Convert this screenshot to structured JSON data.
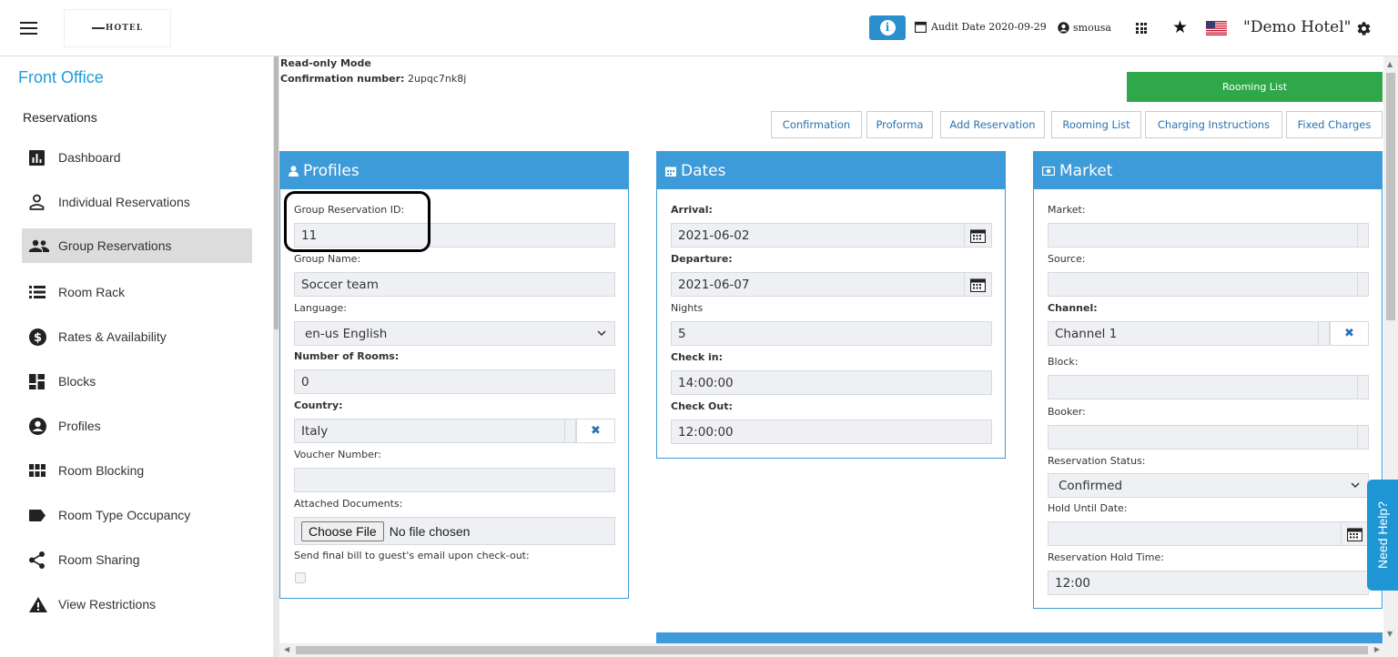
{
  "topbar": {
    "logo_text": "HOTEL",
    "audit_date": "Audit Date 2020-09-29",
    "username": "smousa",
    "hotel_name": "\"Demo Hotel\""
  },
  "sidebar": {
    "title": "Front Office",
    "section": "Reservations",
    "items": [
      {
        "label": "Dashboard",
        "icon": "bar-chart-icon"
      },
      {
        "label": "Individual Reservations",
        "icon": "person-icon"
      },
      {
        "label": "Group Reservations",
        "icon": "group-icon",
        "active": true
      },
      {
        "label": "Room Rack",
        "icon": "list-icon"
      },
      {
        "label": "Rates & Availability",
        "icon": "dollar-icon"
      },
      {
        "label": "Blocks",
        "icon": "dashboard-blocks-icon"
      },
      {
        "label": "Profiles",
        "icon": "account-circle-icon"
      },
      {
        "label": "Room Blocking",
        "icon": "grid-icon"
      },
      {
        "label": "Room Type Occupancy",
        "icon": "label-icon"
      },
      {
        "label": "Room Sharing",
        "icon": "share-icon"
      },
      {
        "label": "View Restrictions",
        "icon": "warning-icon"
      }
    ]
  },
  "main": {
    "mode": "Read-only Mode",
    "confirmation_label": "Confirmation number:",
    "confirmation_number": "2upqc7nk8j",
    "rooming_list_primary": "Rooming List",
    "buttons": [
      "Confirmation",
      "Proforma",
      "Add Reservation",
      "Rooming List",
      "Charging Instructions",
      "Fixed Charges"
    ]
  },
  "profiles": {
    "title": "Profiles",
    "group_id_label": "Group Reservation ID:",
    "group_id": "11",
    "group_name_label": "Group Name:",
    "group_name": "Soccer team",
    "language_label": "Language:",
    "language": "en-us English",
    "rooms_label": "Number of Rooms:",
    "rooms": "0",
    "country_label": "Country:",
    "country": "Italy",
    "voucher_label": "Voucher Number:",
    "voucher": "",
    "docs_label": "Attached Documents:",
    "choose_file": "Choose File",
    "no_file": "No file chosen",
    "send_bill_label": "Send final bill to guest's email upon check-out:"
  },
  "dates": {
    "title": "Dates",
    "arrival_label": "Arrival:",
    "arrival": "2021-06-02",
    "departure_label": "Departure:",
    "departure": "2021-06-07",
    "nights_label": "Nights",
    "nights": "5",
    "checkin_label": "Check in:",
    "checkin": "14:00:00",
    "checkout_label": "Check Out:",
    "checkout": "12:00:00"
  },
  "market": {
    "title": "Market",
    "market_label": "Market:",
    "market": "",
    "source_label": "Source:",
    "source": "",
    "channel_label": "Channel:",
    "channel": "Channel 1",
    "block_label": "Block:",
    "block": "",
    "booker_label": "Booker:",
    "booker": "",
    "status_label": "Reservation Status:",
    "status": "Confirmed",
    "hold_date_label": "Hold Until Date:",
    "hold_date": "",
    "hold_time_label": "Reservation Hold Time:",
    "hold_time": "12:00"
  },
  "help": {
    "label": "Need Help?"
  },
  "colors": {
    "accent": "#3d9bd9",
    "brand": "#1e9bd7",
    "green": "#2fa84a",
    "help": "#1d96d3"
  }
}
